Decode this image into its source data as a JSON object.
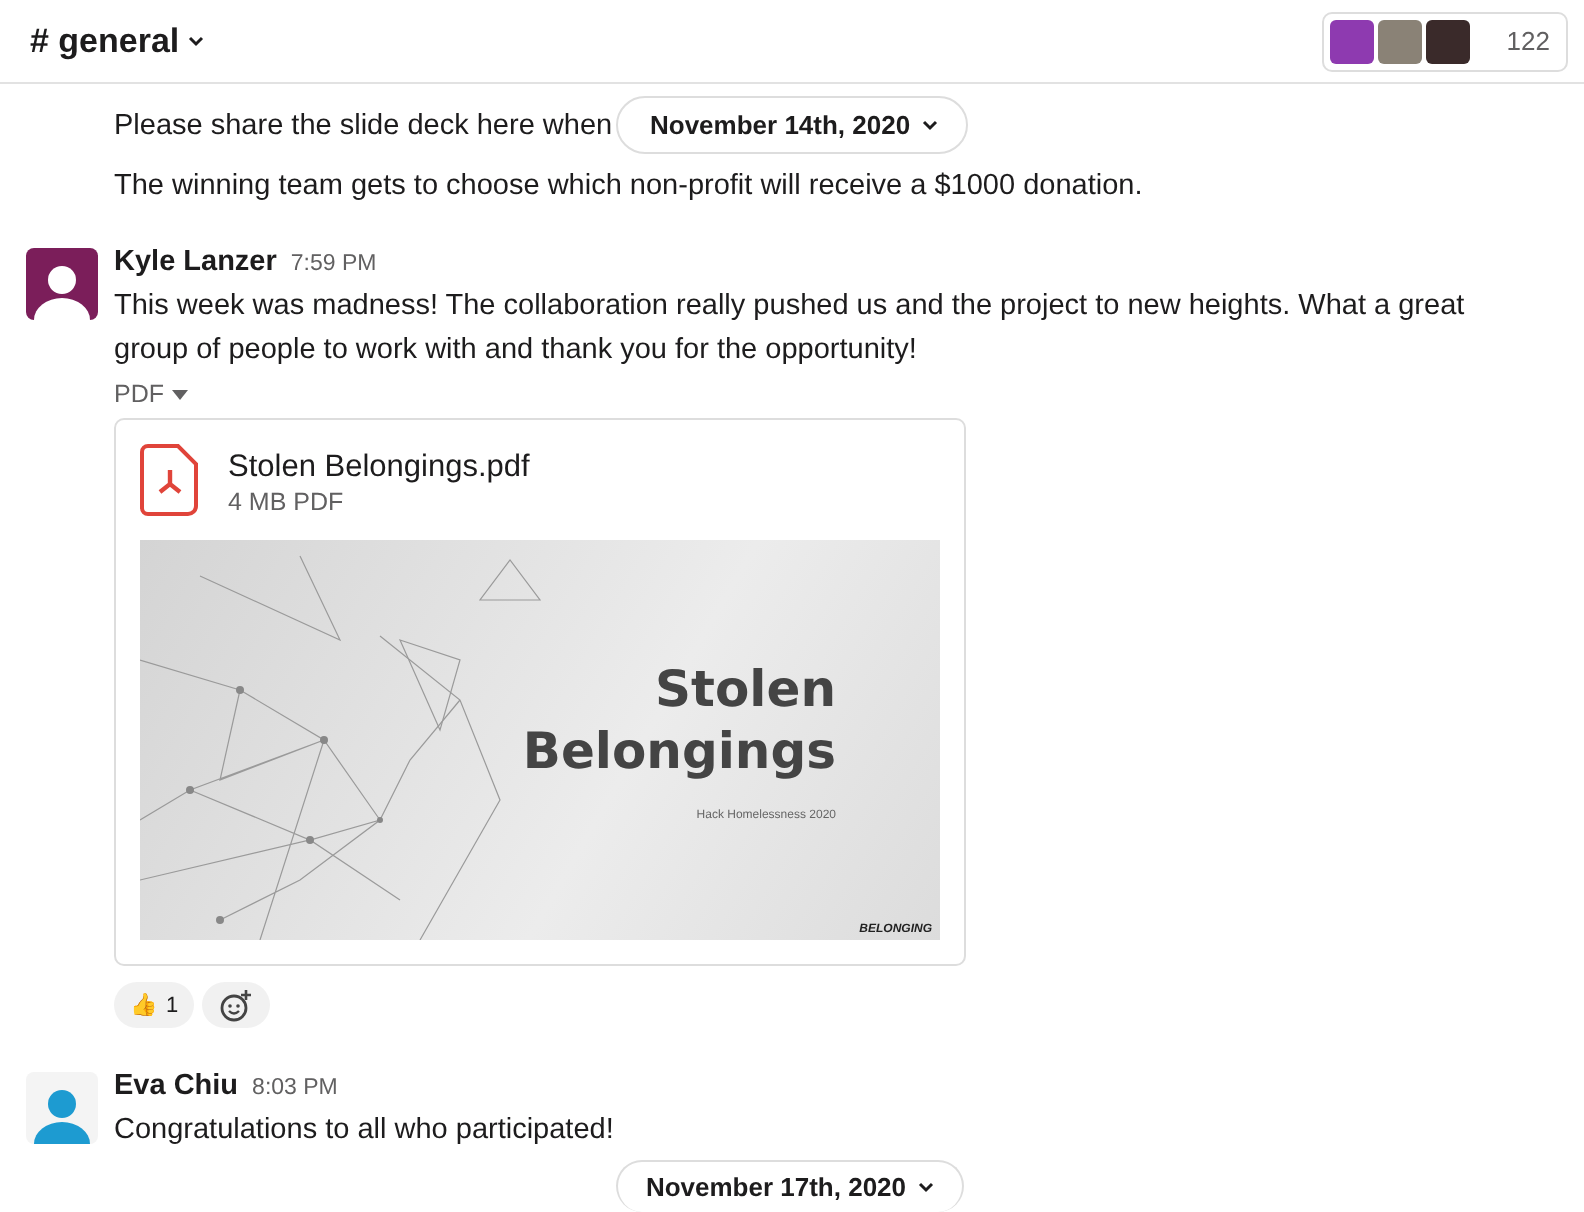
{
  "header": {
    "channel": "# general",
    "member_count": "122"
  },
  "sticky_date": "November 14th, 2020",
  "continued_messages": [
    "Please share the slide deck here when",
    "The winning team gets to choose which non-profit will receive a $1000 donation."
  ],
  "messages": [
    {
      "author": "Kyle Lanzer",
      "time": "7:59 PM",
      "kind": "filled",
      "text": "This week was madness! The collaboration really pushed us and the project to new heights. What a great group of people to work with and thank you for the opportunity!",
      "attachment_label": "PDF",
      "file": {
        "name": "Stolen Belongings.pdf",
        "meta": "4 MB PDF",
        "slide_title": [
          "Stolen",
          "Belongings"
        ],
        "slide_subtitle": "Hack Homelessness 2020",
        "slide_logo": "BELONGING"
      },
      "reactions": [
        {
          "emoji": "👍",
          "count": "1"
        }
      ]
    },
    {
      "author": "Eva Chiu",
      "time": "8:03 PM",
      "kind": "plain",
      "text": "Congratulations to all who participated!"
    }
  ],
  "next_date": "November 17th, 2020"
}
